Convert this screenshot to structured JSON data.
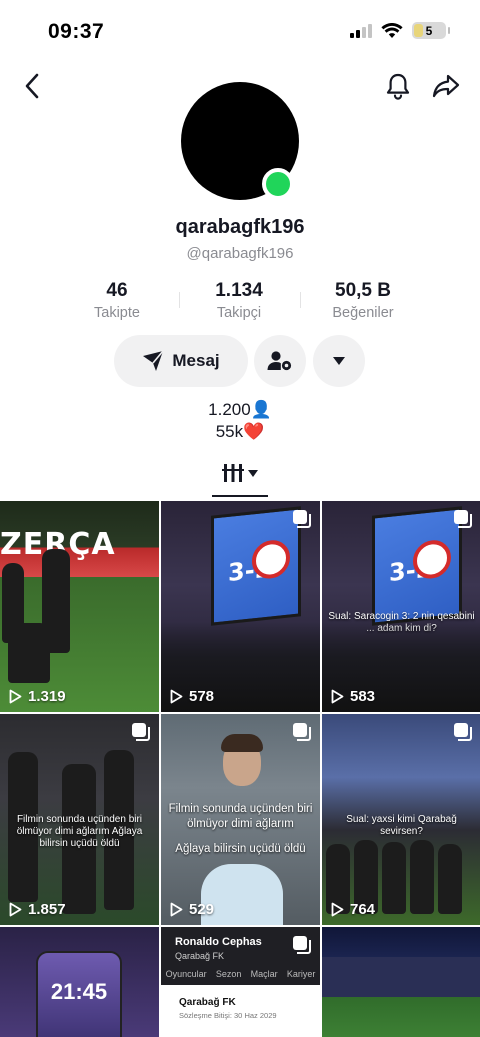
{
  "status_bar": {
    "time": "09:37",
    "battery": "5"
  },
  "profile": {
    "username": "qarabagfk196",
    "handle": "@qarabagfk196"
  },
  "stats": [
    {
      "value": "46",
      "label": "Takipte"
    },
    {
      "value": "1.134",
      "label": "Takipçi"
    },
    {
      "value": "50,5 B",
      "label": "Beğeniler"
    }
  ],
  "actions": {
    "message_label": "Mesaj"
  },
  "bio": {
    "line1": "1.200👤",
    "line2": "55k❤️"
  },
  "videos": [
    {
      "views": "1.319",
      "banner": "ZERÇA"
    },
    {
      "views": "578",
      "score": "3-2"
    },
    {
      "views": "583",
      "score": "3-2",
      "caption": "Sual: Saracogin 3: 2 nin qesabini ... adam kim di?"
    },
    {
      "views": "1.857",
      "caption": "Filmin sonunda uçünden biri ölmüyor dimi ağlarım Ağlaya bilirsin uçüdü öldü"
    },
    {
      "views": "529",
      "caption_line1": "Filmin sonunda uçünden biri",
      "caption_line2": "ölmüyor dimi ağlarım",
      "caption_line3": "Ağlaya bilirsin uçüdü öldü"
    },
    {
      "views": "764",
      "caption": "Sual: yaxsi kimi Qarabağ sevirsen?"
    },
    {
      "phone_time": "21:45"
    },
    {
      "app_title": "Ronaldo Cephas",
      "app_sub": "Qarabağ FK",
      "app_tabs": [
        "Oyuncular",
        "Sezon",
        "Maçlar",
        "Kariyer"
      ],
      "app_club": "Qarabağ FK",
      "app_note": "Sözleşme Bitişi: 30 Haz 2029"
    },
    {
      "scene": "match"
    }
  ]
}
